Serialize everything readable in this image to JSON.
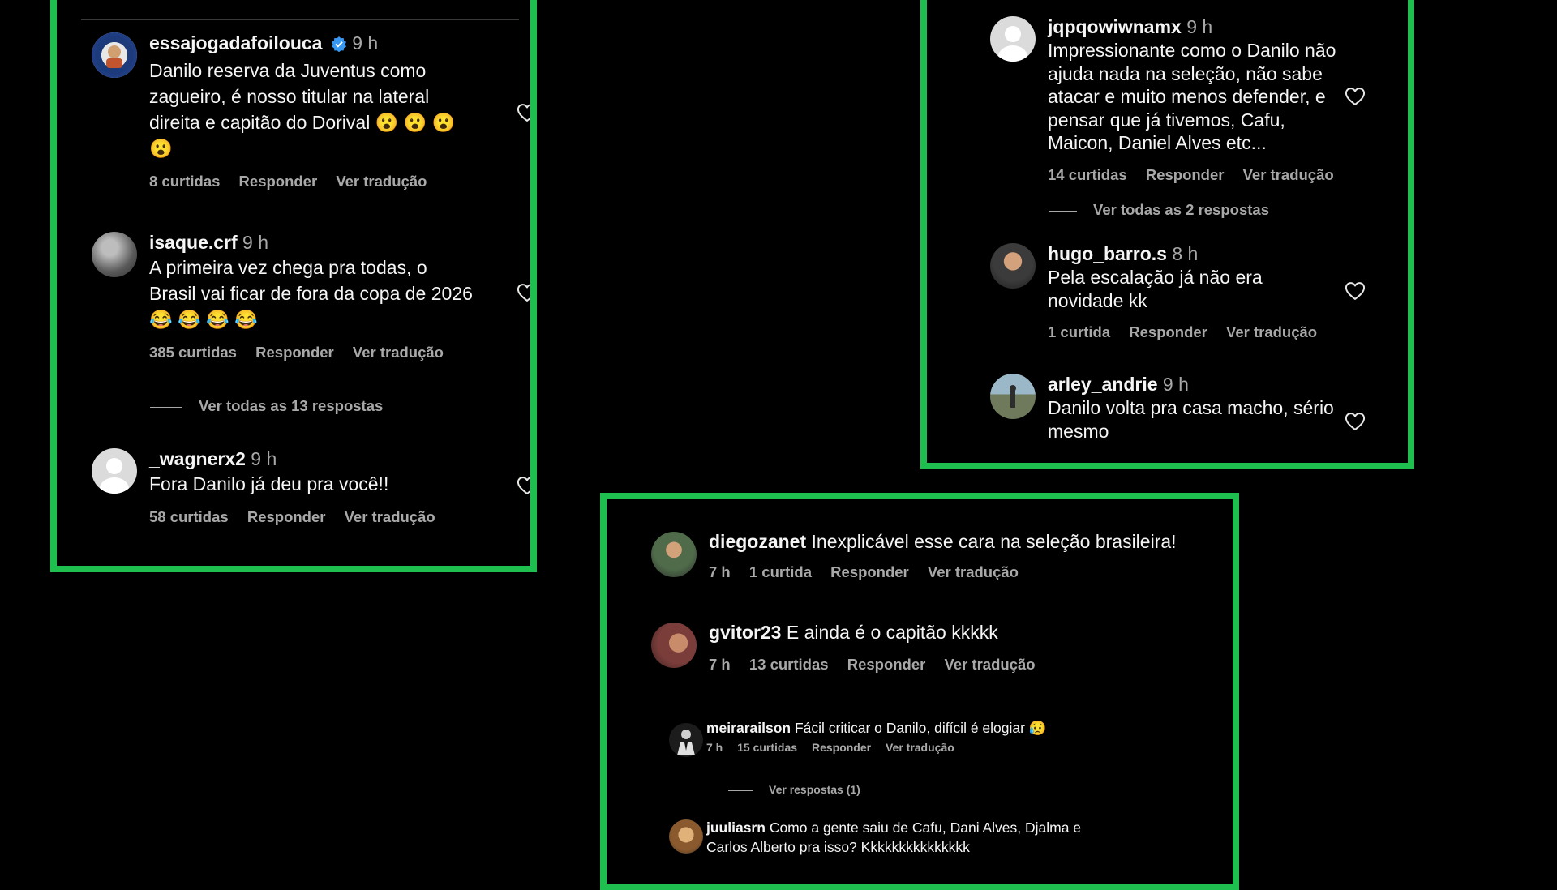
{
  "panel_left": {
    "comments": [
      {
        "username": "essajogadafoilouca",
        "verified": true,
        "time": "9 h",
        "text": "Danilo reserva da Juventus como zagueiro, é nosso titular na lateral direita e capitão do Dorival 😮 😮 😮 😮",
        "likes": "8 curtidas",
        "reply": "Responder",
        "translate": "Ver tradução"
      },
      {
        "username": "isaque.crf",
        "time": "9 h",
        "text": "A primeira vez chega pra todas, o Brasil vai ficar de fora da copa de 2026 😂 😂 😂 😂",
        "likes": "385 curtidas",
        "reply": "Responder",
        "translate": "Ver tradução",
        "view_replies": "Ver todas as 13 respostas"
      },
      {
        "username": "_wagnerx2",
        "time": "9 h",
        "text": "Fora Danilo já deu pra você!!",
        "likes": "58 curtidas",
        "reply": "Responder",
        "translate": "Ver tradução"
      }
    ]
  },
  "panel_right": {
    "comments": [
      {
        "username": "jqpqowiwnamx",
        "time": "9 h",
        "text": "Impressionante como o Danilo não ajuda nada na seleção, não sabe atacar e muito menos defender, e pensar que já tivemos, Cafu, Maicon, Daniel Alves etc...",
        "likes": "14 curtidas",
        "reply": "Responder",
        "translate": "Ver tradução",
        "view_replies": "Ver todas as 2 respostas"
      },
      {
        "username": "hugo_barro.s",
        "time": "8 h",
        "text": "Pela escalação já não era novidade kk",
        "likes": "1 curtida",
        "reply": "Responder",
        "translate": "Ver tradução"
      },
      {
        "username": "arley_andrie",
        "time": "9 h",
        "text": "Danilo volta pra casa macho, sério mesmo"
      }
    ]
  },
  "panel_bottom": {
    "comments": [
      {
        "username": "diegozanet",
        "text": "Inexplicável esse cara na seleção brasileira!",
        "time": "7 h",
        "likes": "1 curtida",
        "reply": "Responder",
        "translate": "Ver tradução"
      },
      {
        "username": "gvitor23",
        "text": "E ainda é o capitão kkkkk",
        "time": "7 h",
        "likes": "13 curtidas",
        "reply": "Responder",
        "translate": "Ver tradução"
      },
      {
        "username": "meirarailson",
        "text": "Fácil criticar o Danilo, difícil é elogiar 😥",
        "time": "7 h",
        "likes": "15 curtidas",
        "reply": "Responder",
        "translate": "Ver tradução",
        "view_replies": "Ver respostas (1)"
      },
      {
        "username": "juuliasrn",
        "text": "Como a gente saiu de Cafu, Dani Alves, Djalma e Carlos Alberto pra isso? Kkkkkkkkkkkkkkk"
      }
    ]
  },
  "icons": {
    "heart": "heart-outline-icon",
    "verified": "verified-badge-icon"
  },
  "colors": {
    "border": "#1fbf4f",
    "background": "#000000",
    "muted_text": "#a8a8a8",
    "verified": "#3897f0"
  }
}
